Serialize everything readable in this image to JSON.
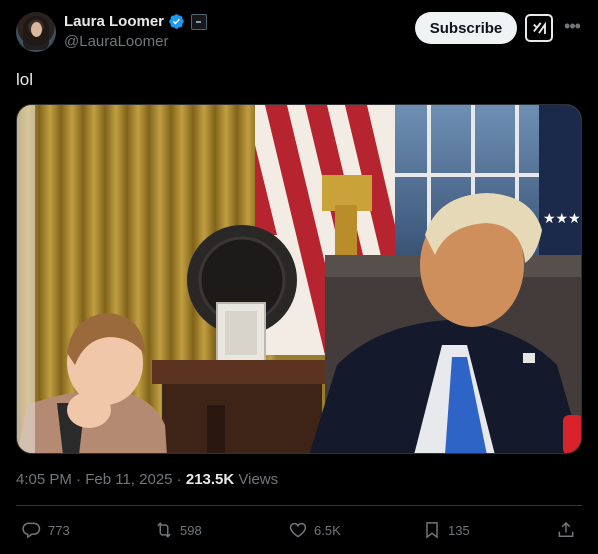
{
  "author": {
    "display_name": "Laura Loomer",
    "handle": "@LauraLoomer",
    "verified_icon": "verified-badge-icon",
    "affiliate_icon": "affiliate-badge-icon"
  },
  "header": {
    "subscribe_label": "Subscribe",
    "grok_icon": "grok-icon",
    "more_icon": "more-options-icon"
  },
  "tweet": {
    "text": "lol",
    "media": "photo"
  },
  "meta": {
    "time": "4:05 PM",
    "separator1": " · ",
    "date": "Feb 11, 2025",
    "separator2": " · ",
    "views_count": "213.5K",
    "views_label": " Views"
  },
  "actions": {
    "replies": "773",
    "reposts": "598",
    "likes": "6.5K",
    "bookmarks": "135"
  },
  "colors": {
    "background": "#000000",
    "text": "#e7e9ea",
    "muted": "#71767b",
    "verified": "#1d9bf0",
    "border": "#2f3336"
  }
}
